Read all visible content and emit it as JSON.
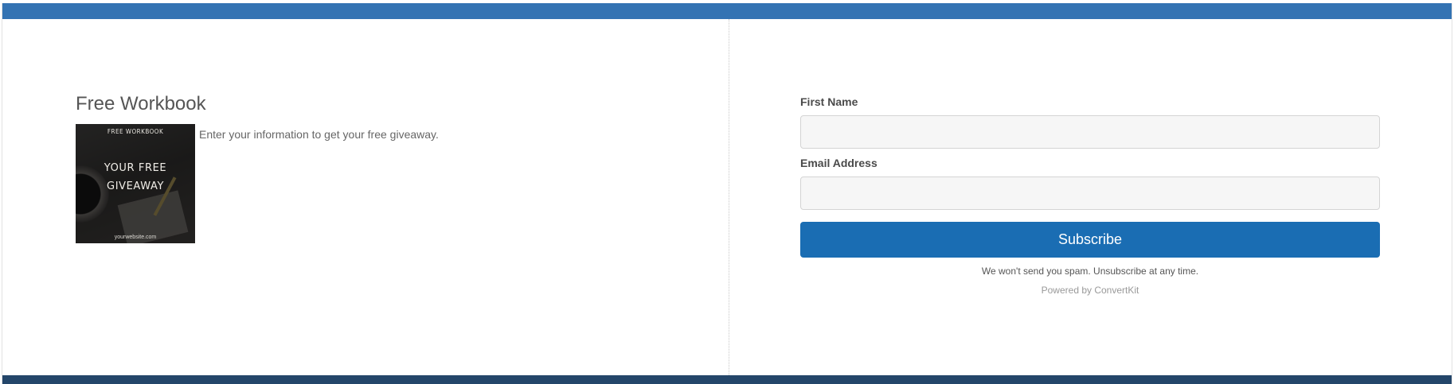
{
  "colors": {
    "top_bar": "#3473b3",
    "bottom_bar": "#24466a",
    "button": "#1a6db3",
    "field_background": "#f6f6f6"
  },
  "left": {
    "heading": "Free Workbook",
    "description": "Enter your information to get your free giveaway.",
    "cover": {
      "top_text": "FREE WORKBOOK",
      "main_text": "YOUR FREE\nGIVEAWAY",
      "footer_text": "yourwebsite.com"
    }
  },
  "form": {
    "first_name_label": "First Name",
    "first_name_value": "",
    "email_label": "Email Address",
    "email_value": "",
    "subscribe_label": "Subscribe",
    "spam_note": "We won't send you spam. Unsubscribe at any time.",
    "powered_by": "Powered by ConvertKit"
  }
}
